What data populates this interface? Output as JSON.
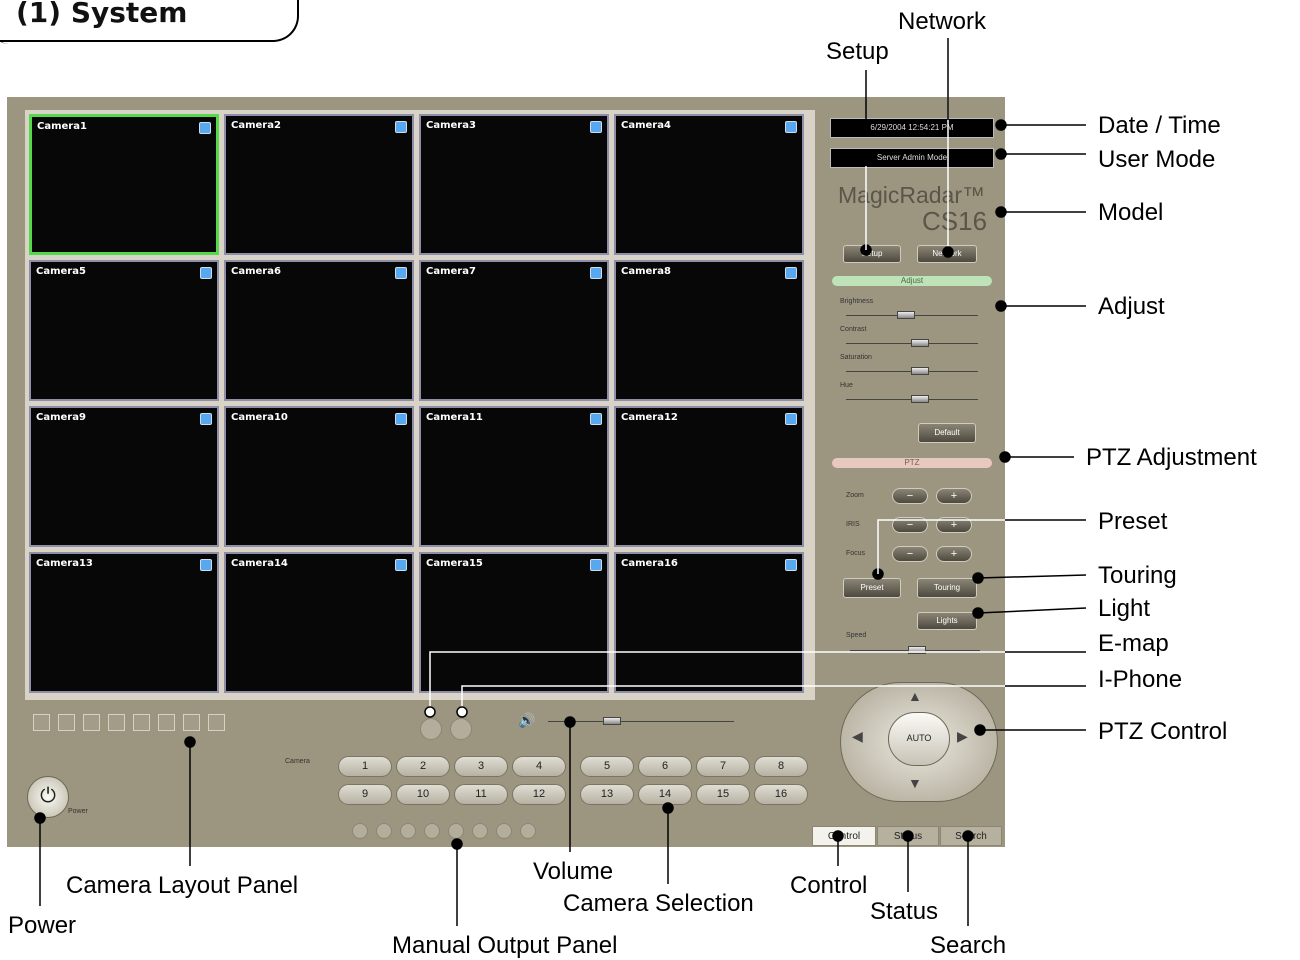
{
  "section_title": "(1) System",
  "app": {
    "cameras": [
      "Camera1",
      "Camera2",
      "Camera3",
      "Camera4",
      "Camera5",
      "Camera6",
      "Camera7",
      "Camera8",
      "Camera9",
      "Camera10",
      "Camera11",
      "Camera12",
      "Camera13",
      "Camera14",
      "Camera15",
      "Camera16"
    ],
    "selected_camera": "Camera1",
    "datetime": "6/29/2004 12:54:21 PM",
    "user_mode": "Server Admin Mode",
    "brand": "MagicRadar™",
    "model": "CS16",
    "setup_label": "Setup",
    "network_label": "Network",
    "adjust_header": "Adjust",
    "adjust_sliders": [
      "Brightness",
      "Contrast",
      "Saturation",
      "Hue"
    ],
    "default_label": "Default",
    "ptz_header": "PTZ",
    "ptz_rows": [
      "Zoom",
      "IRIS",
      "Focus"
    ],
    "minus": "−",
    "plus": "+",
    "preset_label": "Preset",
    "touring_label": "Touring",
    "lights_label": "Lights",
    "speed_label": "Speed",
    "auto_label": "AUTO",
    "camera_label": "Camera",
    "camera_buttons": [
      "1",
      "2",
      "3",
      "4",
      "5",
      "6",
      "7",
      "8",
      "9",
      "10",
      "11",
      "12",
      "13",
      "14",
      "15",
      "16"
    ],
    "power_label": "Power",
    "tabs": [
      "Control",
      "Status",
      "Search"
    ]
  },
  "annotations": {
    "network": "Network",
    "setup": "Setup",
    "date_time": "Date / Time",
    "user_mode": "User Mode",
    "model": "Model",
    "adjust": "Adjust",
    "ptz_adjustment": "PTZ Adjustment",
    "preset": "Preset",
    "touring": "Touring",
    "light": "Light",
    "emap": "E-map",
    "iphone": "I-Phone",
    "ptz_control": "PTZ Control",
    "camera_layout_panel": "Camera Layout Panel",
    "power": "Power",
    "manual_output_panel": "Manual Output Panel",
    "volume": "Volume",
    "camera_selection": "Camera Selection",
    "control": "Control",
    "status": "Status",
    "search": "Search"
  },
  "colors": {
    "app_bg": "#9c9580",
    "selected_border": "#55d94a",
    "adjust_bar": "#bfe3b8",
    "ptz_bar": "#e8c9bf"
  }
}
